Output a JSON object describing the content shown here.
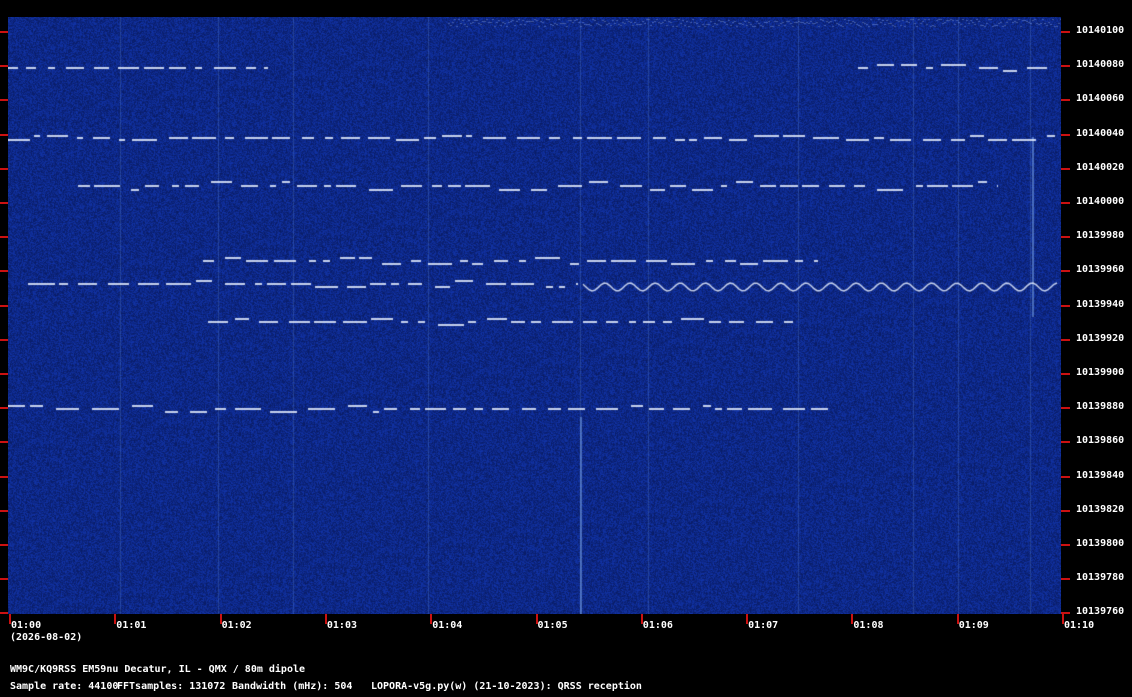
{
  "y_axis": {
    "labels": [
      "10140100",
      "10140080",
      "10140060",
      "10140040",
      "10140020",
      "10140000",
      "10139980",
      "10139960",
      "10139940",
      "10139920",
      "10139900",
      "10139880",
      "10139860",
      "10139840",
      "10139820",
      "10139800",
      "10139780",
      "10139760"
    ]
  },
  "x_axis": {
    "labels": [
      "01:00",
      "01:01",
      "01:02",
      "01:03",
      "01:04",
      "01:05",
      "01:06",
      "01:07",
      "01:08",
      "01:09",
      "01:10"
    ],
    "date": "(2026-08-02)"
  },
  "footer": {
    "station": "WM9C/KQ9RSS EM59nu Decatur, IL - QMX / 80m dipole",
    "sample_rate": "Sample rate: 44100",
    "fft_samples": "FFTsamples: 131072",
    "bandwidth": "Bandwidth (mHz): 504",
    "software": "LOPORA-v5g.py(w) (21-10-2023): QRSS reception"
  },
  "colors": {
    "background": "#000000",
    "waterfall": "#0d2f6e",
    "signal": "#e8f0ff",
    "tick": "#cc1111"
  }
}
